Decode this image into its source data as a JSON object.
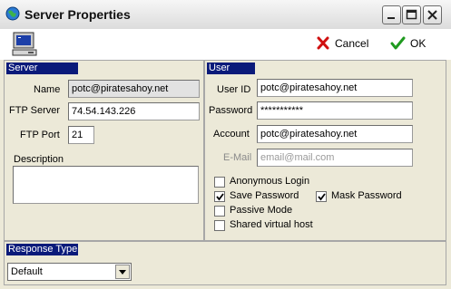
{
  "window": {
    "title": "Server Properties"
  },
  "toolbar": {
    "cancel_label": "Cancel",
    "ok_label": "OK"
  },
  "server": {
    "header": "Server",
    "name_label": "Name",
    "name_value": "potc@piratesahoy.net",
    "ftp_server_label": "FTP Server",
    "ftp_server_value": "74.54.143.226",
    "ftp_port_label": "FTP Port",
    "ftp_port_value": "21",
    "description_label": "Description",
    "description_value": ""
  },
  "user": {
    "header": "User",
    "user_id_label": "User ID",
    "user_id_value": "potc@piratesahoy.net",
    "password_label": "Password",
    "password_value": "***********",
    "account_label": "Account",
    "account_value": "potc@piratesahoy.net",
    "email_label": "E-Mail",
    "email_placeholder": "email@mail.com",
    "options": [
      {
        "label": "Anonymous Login",
        "checked": false
      },
      {
        "label": "Save Password",
        "checked": true
      },
      {
        "label": "Mask Password",
        "checked": true
      },
      {
        "label": "Passive Mode",
        "checked": false
      },
      {
        "label": "Shared virtual host",
        "checked": false
      }
    ]
  },
  "response": {
    "header": "Response Type",
    "selected": "Default"
  },
  "icons": {
    "app": "globe-icon",
    "computer": "computer-icon",
    "cancel": "red-x-icon",
    "ok": "green-check-icon",
    "minimize": "minimize-icon",
    "maximize": "maximize-icon",
    "close": "close-icon"
  },
  "colors": {
    "section_header": "#0a1a7a",
    "cancel": "#d01010",
    "ok": "#1f9a1f"
  }
}
